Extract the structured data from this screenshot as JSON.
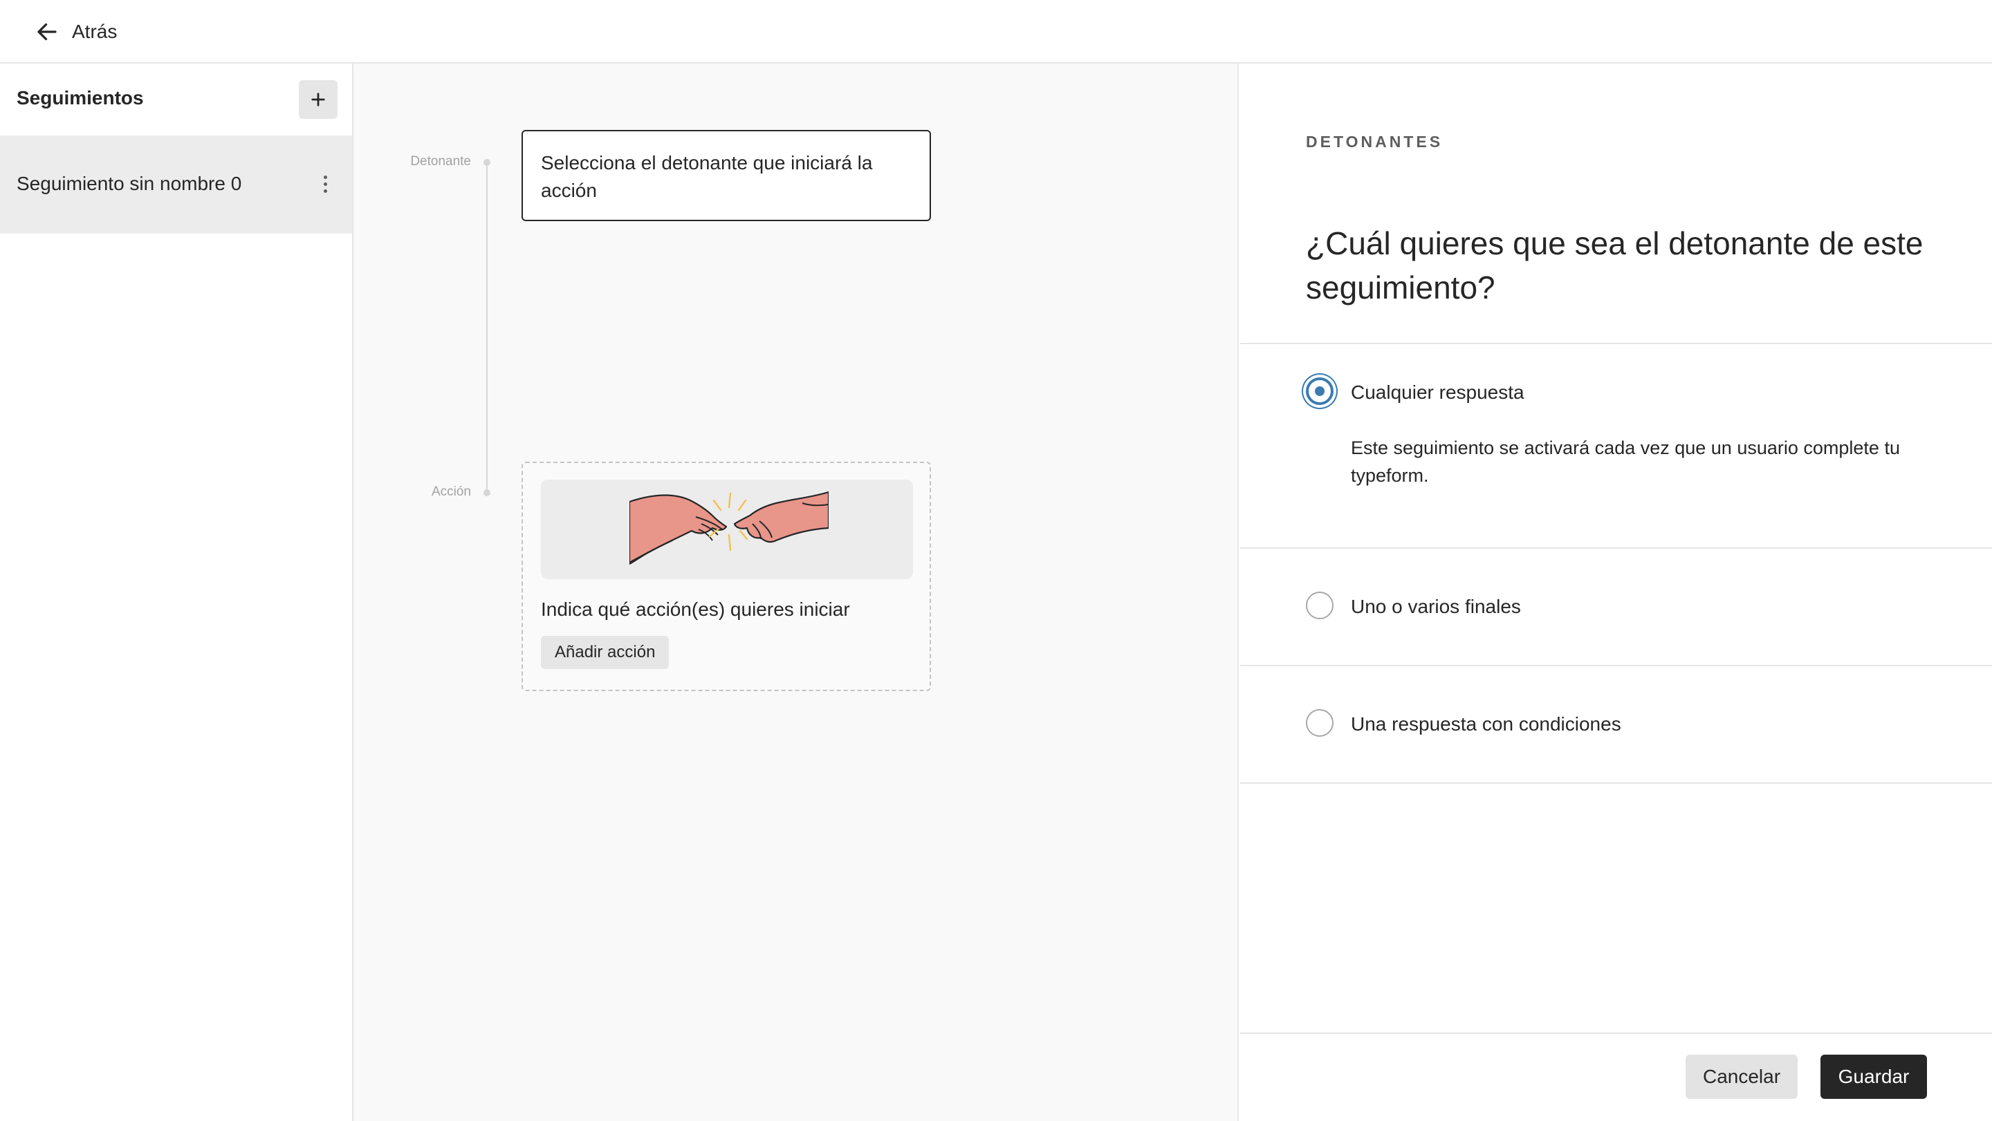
{
  "topbar": {
    "back_label": "Atrás",
    "back_icon": "arrow-left-icon"
  },
  "sidebar": {
    "title": "Seguimientos",
    "add_icon": "plus-icon",
    "items": [
      {
        "label": "Seguimiento sin nombre 0",
        "menu_icon": "kebab-menu-icon"
      }
    ]
  },
  "canvas": {
    "trigger_label": "Detonante",
    "trigger_card_text": "Selecciona el detonante que iniciará la acción",
    "action_label": "Acción",
    "action_title": "Indica qué acción(es) quieres iniciar",
    "add_action_label": "Añadir acción",
    "illustration": "hands-touching-illustration"
  },
  "panel": {
    "eyebrow": "DETONANTES",
    "question": "¿Cuál quieres que sea el detonante de este seguimiento?",
    "options": [
      {
        "label": "Cualquier respuesta",
        "description": "Este seguimiento se activará cada vez que un usuario complete tu typeform.",
        "selected": true
      },
      {
        "label": "Uno o varios finales",
        "selected": false
      },
      {
        "label": "Una respuesta con condiciones",
        "selected": false
      }
    ],
    "cancel_label": "Cancelar",
    "save_label": "Guardar"
  },
  "colors": {
    "accent": "#3a7bb1",
    "primary_button": "#262627",
    "secondary_button": "#e3e3e3",
    "selected_item_bg": "#ececec",
    "illustration_skin": "#e8958a",
    "illustration_spark": "#f2c14e"
  }
}
